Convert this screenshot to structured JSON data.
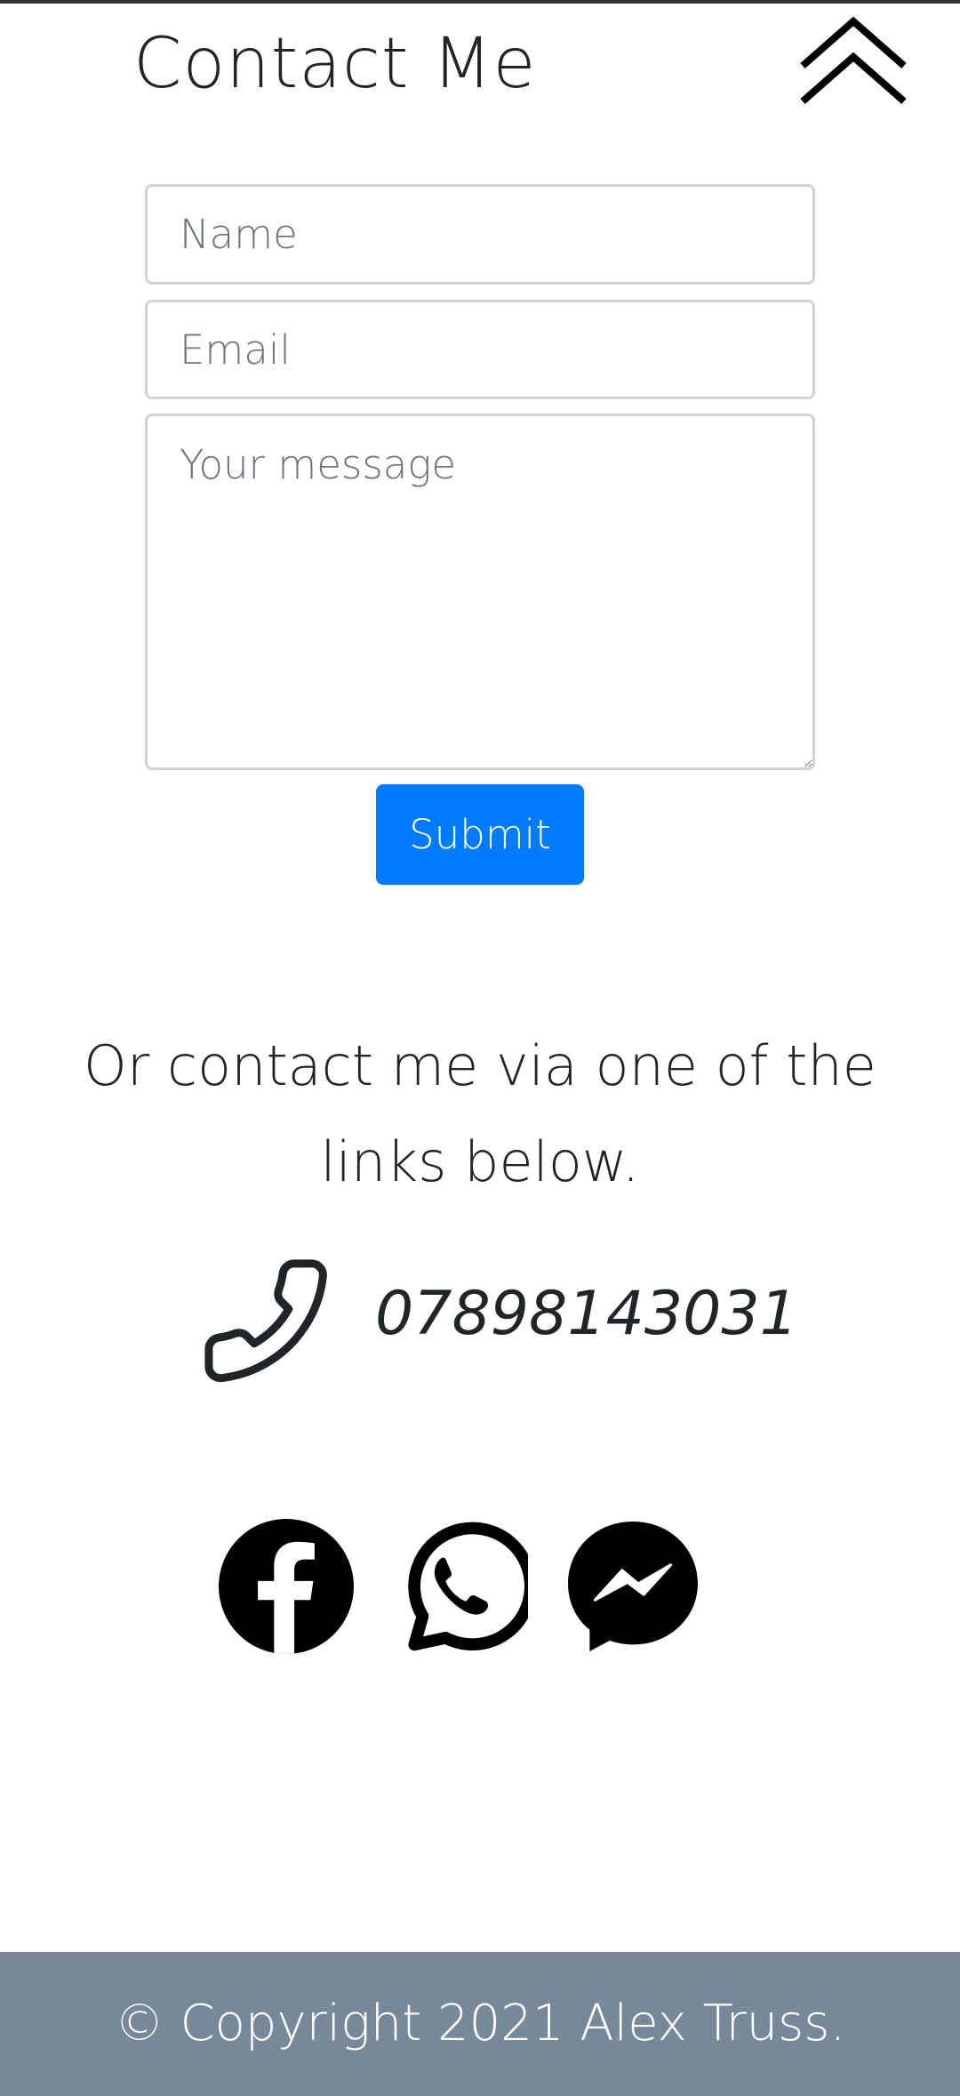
{
  "page": {
    "title": "Contact Me",
    "back_to_top_icon": "double-chevron-up-icon"
  },
  "form": {
    "name_placeholder": "Name",
    "email_placeholder": "Email",
    "message_placeholder": "Your message",
    "submit_label": "Submit"
  },
  "alt_contact": {
    "text": "Or contact me via one of the links below.",
    "phone_icon": "phone-icon",
    "phone_number": "07898143031"
  },
  "social": [
    {
      "name": "Facebook",
      "icon": "facebook-icon"
    },
    {
      "name": "WhatsApp",
      "icon": "whatsapp-icon"
    },
    {
      "name": "Messenger",
      "icon": "messenger-icon"
    }
  ],
  "footer": {
    "copyright": "© Copyright 2021 Alex Truss."
  },
  "colors": {
    "accent": "#007bff",
    "footer_bg": "#778899",
    "text": "#212529",
    "icon": "#000000",
    "input_border": "#ced4da",
    "top_rule": "#333333"
  }
}
